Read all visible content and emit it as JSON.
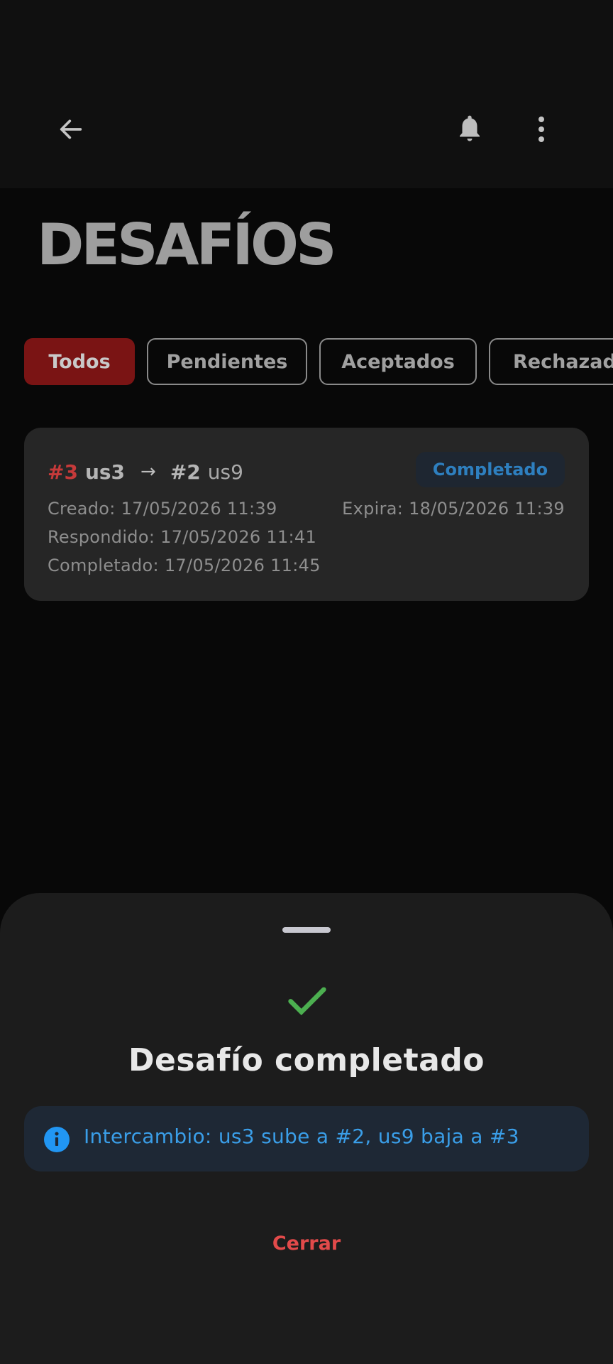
{
  "header": {
    "back_icon": "arrow-left-icon",
    "bell_icon": "bell-icon",
    "more_icon": "more-vertical-icon"
  },
  "page": {
    "title": "DESAFÍOS"
  },
  "filters": [
    {
      "label": "Todos",
      "active": true
    },
    {
      "label": "Pendientes",
      "active": false
    },
    {
      "label": "Aceptados",
      "active": false
    },
    {
      "label": "Rechazad",
      "active": false
    }
  ],
  "challenge": {
    "challenger_rank": "#3",
    "challenger_user": "us3",
    "target_rank": "#2",
    "target_user": "us9",
    "status": "Completado",
    "created": "Creado: 17/05/2026 11:39",
    "expires": "Expira: 18/05/2026 11:39",
    "responded": "Respondido: 17/05/2026 11:41",
    "completed": "Completado: 17/05/2026 11:45"
  },
  "sheet": {
    "title": "Desafío completado",
    "info": "Intercambio: us3 sube a #2, us9 baja a #3",
    "close_label": "Cerrar"
  },
  "colors": {
    "accent_red": "#7a1414",
    "status_blue": "#2e7fbf",
    "success_green": "#4caf50",
    "info_blue": "#3a9ee8",
    "close_red": "#e24a4a"
  }
}
